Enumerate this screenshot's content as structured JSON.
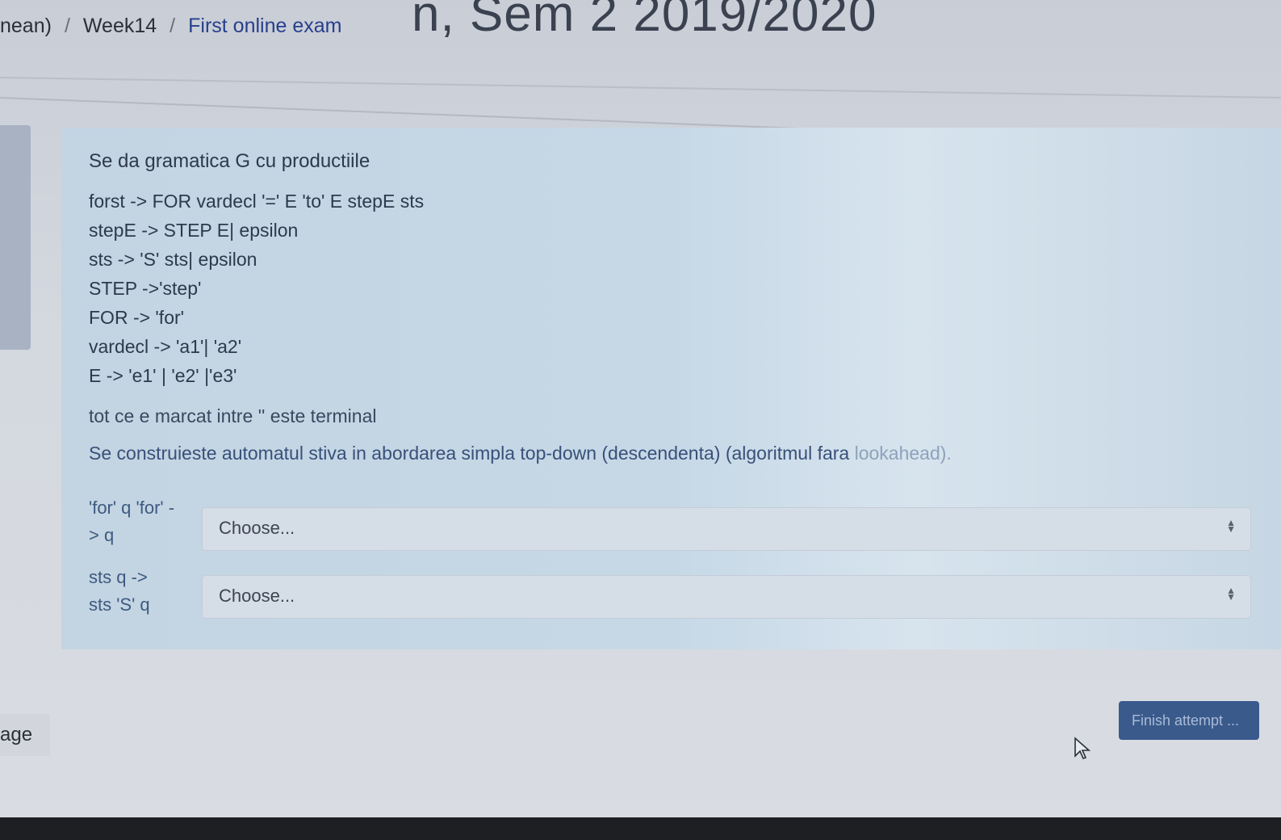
{
  "header": {
    "title": "n, Sem 2 2019/2020",
    "breadcrumb": [
      "nean)",
      "Week14",
      "First online exam"
    ]
  },
  "question": {
    "intro": "Se da gramatica G cu productiile",
    "productions": [
      "forst -> FOR vardecl '=' E 'to' E stepE sts",
      "stepE -> STEP E| epsilon",
      "sts -> 'S' sts| epsilon",
      "STEP ->'step'",
      "FOR -> 'for'",
      "vardecl -> 'a1'| 'a2'",
      "E -> 'e1' | 'e2' |'e3'"
    ],
    "note": "tot ce e marcat intre '' este terminal",
    "description": "Se construieste automatul stiva in abordarea simpla top-down (descendenta) (algoritmul fara ",
    "description_faded": "lookahead).",
    "matches": [
      {
        "label_line1": "'for' q 'for' -",
        "label_line2": "> q",
        "select": "Choose..."
      },
      {
        "label_line1": "sts q ->",
        "label_line2": "sts 'S' q",
        "select": "Choose..."
      }
    ]
  },
  "footer": {
    "page_label": "age",
    "finish_button": "Finish attempt ..."
  },
  "colors": {
    "panel": "#c6d8e6",
    "button": "#3a5a8c",
    "link": "#27408b"
  }
}
